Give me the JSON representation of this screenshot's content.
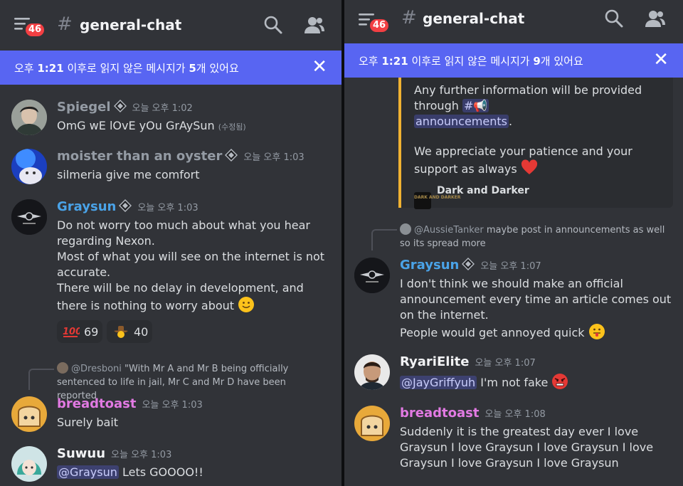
{
  "left": {
    "header": {
      "badge": "46",
      "hash": "#",
      "channel": "general-chat"
    },
    "banner": {
      "prefix": "오후 ",
      "time": "1:21",
      "middle": " 이후로 읽지 않은 메시지가 ",
      "count": "5",
      "suffix": "개 있어요",
      "close": "✕"
    },
    "messages": [
      {
        "user": "Spiegel",
        "color": "#949ba4",
        "time": "오늘 오후 1:02",
        "text": "OmG wE lOvE yOu GrAySun",
        "edited": "(수정됨)"
      },
      {
        "user": "moister than an oyster",
        "color": "#949ba4",
        "time": "오늘 오후 1:03",
        "text": "silmeria give me comfort"
      },
      {
        "user": "Graysun",
        "color": "#4aa3e8",
        "time": "오늘 오후 1:03",
        "lines": [
          "Do not worry too much about what you hear regarding Nexon.",
          "Most of what you will see on the internet is not accurate.",
          "There will be no delay in development, and there is nothing to worry about"
        ]
      },
      {
        "reply_user": "@Dresboni",
        "reply_text": "\"With Mr A and Mr B being officially sentenced to life in jail, Mr C and Mr D have been reported",
        "user": "breadtoast",
        "color": "#e27ae3",
        "time": "오늘 오후 1:03",
        "text": "Surely bait"
      },
      {
        "user": "Suwuu",
        "color": "#f2f3f5",
        "time": "오늘 오후 1:03",
        "mention": "@Graysun",
        "text": " Lets GOOOO!!"
      }
    ],
    "reactions": [
      {
        "emoji": "100",
        "count": "69"
      },
      {
        "emoji": "cowboy",
        "count": "40"
      }
    ]
  },
  "right": {
    "header": {
      "badge": "46",
      "hash": "#",
      "channel": "general-chat"
    },
    "banner": {
      "prefix": "오후 ",
      "time": "1:21",
      "middle": " 이후로 읽지 않은 메시지가 ",
      "count": "9",
      "suffix": "개 있어요",
      "close": "✕"
    },
    "embed": {
      "line1": "Any further information will be provided through",
      "channel_hash": "#📢",
      "channel": "announcements",
      "line2": "We appreciate your patience and your support as always",
      "footer": "Dark and Darker",
      "footer_logo": "DARK AND DARKER"
    },
    "messages": [
      {
        "reply_user": "@AussieTanker",
        "reply_text": "maybe post in announcements as well so its spread more",
        "user": "Graysun",
        "color": "#4aa3e8",
        "time": "오늘 오후 1:07",
        "lines": [
          "I don't think we should make an official announcement every time an article comes out on the internet.",
          "People would get annoyed quick"
        ]
      },
      {
        "user": "RyariElite",
        "color": "#f2f3f5",
        "time": "오늘 오후 1:07",
        "mention": "@JayGriffyuh",
        "text": " I'm not fake"
      },
      {
        "user": "breadtoast",
        "color": "#e27ae3",
        "time": "오늘 오후 1:08",
        "text": "Suddenly it is the greatest day ever I love Graysun I love Graysun I love Graysun I love Graysun I love Graysun I love Graysun"
      }
    ]
  },
  "icons": {
    "menu": "menu-icon",
    "search": "search-icon",
    "members": "members-icon",
    "close": "close-icon"
  }
}
